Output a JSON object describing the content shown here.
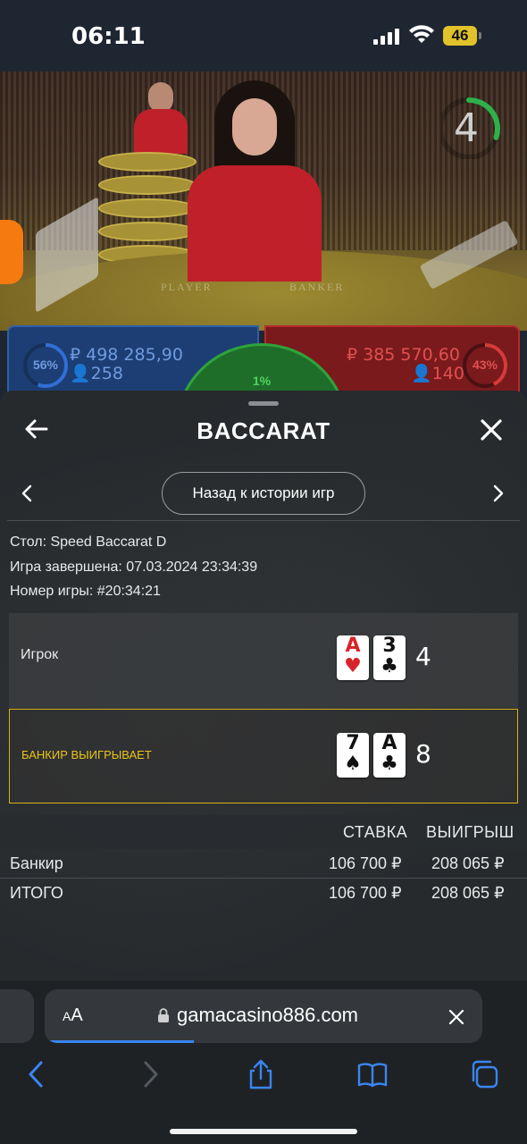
{
  "status_bar": {
    "time": "06:11",
    "battery": "46"
  },
  "live_video": {
    "felt_player": "PLAYER",
    "felt_banker": "BANKER",
    "countdown": "4",
    "countdown_color": "#2fb04a"
  },
  "bets": {
    "player": {
      "amount": "₽ 498 285,90",
      "players": "258",
      "percent": "56%",
      "percent_value": 56,
      "color": "#2f6fd6"
    },
    "banker": {
      "amount": "₽ 385 570,60",
      "players": "140",
      "percent": "43%",
      "percent_value": 43,
      "color": "#d63a3a"
    },
    "tie": {
      "percent": "1%",
      "color": "#2fa33c"
    }
  },
  "sheet": {
    "title": "BACCARAT",
    "history_button": "Назад к истории игр",
    "info": {
      "table_label": "Стол:",
      "table_value": "Speed Baccarat D",
      "finished_label": "Игра завершена:",
      "finished_value": "07.03.2024 23:34:39",
      "number_label": "Номер игры:",
      "number_value": "#20:34:21"
    },
    "hands": {
      "player": {
        "label": "Игрок",
        "score": "4",
        "cards": [
          {
            "rank": "A",
            "suit": "♥",
            "color": "red"
          },
          {
            "rank": "3",
            "suit": "♣",
            "color": "black"
          }
        ]
      },
      "banker": {
        "label": "БАНКИР ВЫИГРЫВАЕТ",
        "score": "8",
        "cards": [
          {
            "rank": "7",
            "suit": "♠",
            "color": "black"
          },
          {
            "rank": "A",
            "suit": "♣",
            "color": "black"
          }
        ]
      }
    },
    "table": {
      "headers": {
        "bet": "СТАВКА",
        "win": "ВЫИГРЫШ"
      },
      "rows": [
        {
          "name": "Банкир",
          "bet": "106 700 ₽",
          "win": "208 065 ₽"
        },
        {
          "name": "ИТОГО",
          "bet": "106 700 ₽",
          "win": "208 065 ₽"
        }
      ]
    }
  },
  "browser": {
    "text_size_button": "AA",
    "url": "gamacasino886.com",
    "load_progress": 0.34,
    "accent": "#3a86f2"
  }
}
